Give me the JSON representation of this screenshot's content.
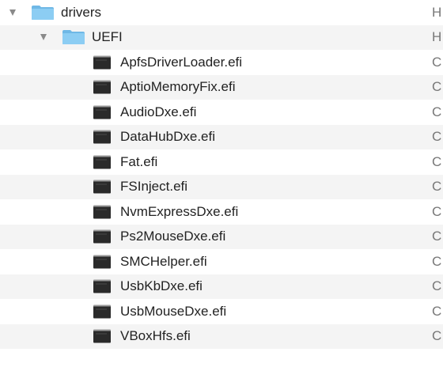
{
  "tree": {
    "root": {
      "name": "drivers",
      "icon": "folder-icon",
      "expanded": true,
      "kind_clipped": "H"
    },
    "subfolder": {
      "name": "UEFI",
      "icon": "folder-icon",
      "expanded": true,
      "kind_clipped": "H"
    },
    "files": [
      {
        "name": "ApfsDriverLoader.efi",
        "icon": "executable-icon",
        "kind_clipped": "C"
      },
      {
        "name": "AptioMemoryFix.efi",
        "icon": "executable-icon",
        "kind_clipped": "C"
      },
      {
        "name": "AudioDxe.efi",
        "icon": "executable-icon",
        "kind_clipped": "C"
      },
      {
        "name": "DataHubDxe.efi",
        "icon": "executable-icon",
        "kind_clipped": "C"
      },
      {
        "name": "Fat.efi",
        "icon": "executable-icon",
        "kind_clipped": "C"
      },
      {
        "name": "FSInject.efi",
        "icon": "executable-icon",
        "kind_clipped": "C"
      },
      {
        "name": "NvmExpressDxe.efi",
        "icon": "executable-icon",
        "kind_clipped": "C"
      },
      {
        "name": "Ps2MouseDxe.efi",
        "icon": "executable-icon",
        "kind_clipped": "C"
      },
      {
        "name": "SMCHelper.efi",
        "icon": "executable-icon",
        "kind_clipped": "C"
      },
      {
        "name": "UsbKbDxe.efi",
        "icon": "executable-icon",
        "kind_clipped": "C"
      },
      {
        "name": "UsbMouseDxe.efi",
        "icon": "executable-icon",
        "kind_clipped": "C"
      },
      {
        "name": "VBoxHfs.efi",
        "icon": "executable-icon",
        "kind_clipped": "C"
      }
    ]
  },
  "colors": {
    "folder_body": "#8ccdf3",
    "folder_tab": "#6fb8e6",
    "row_alt": "#f4f4f4",
    "disclosure": "#8a8a8a",
    "exec_icon": "#2a2a2a"
  }
}
